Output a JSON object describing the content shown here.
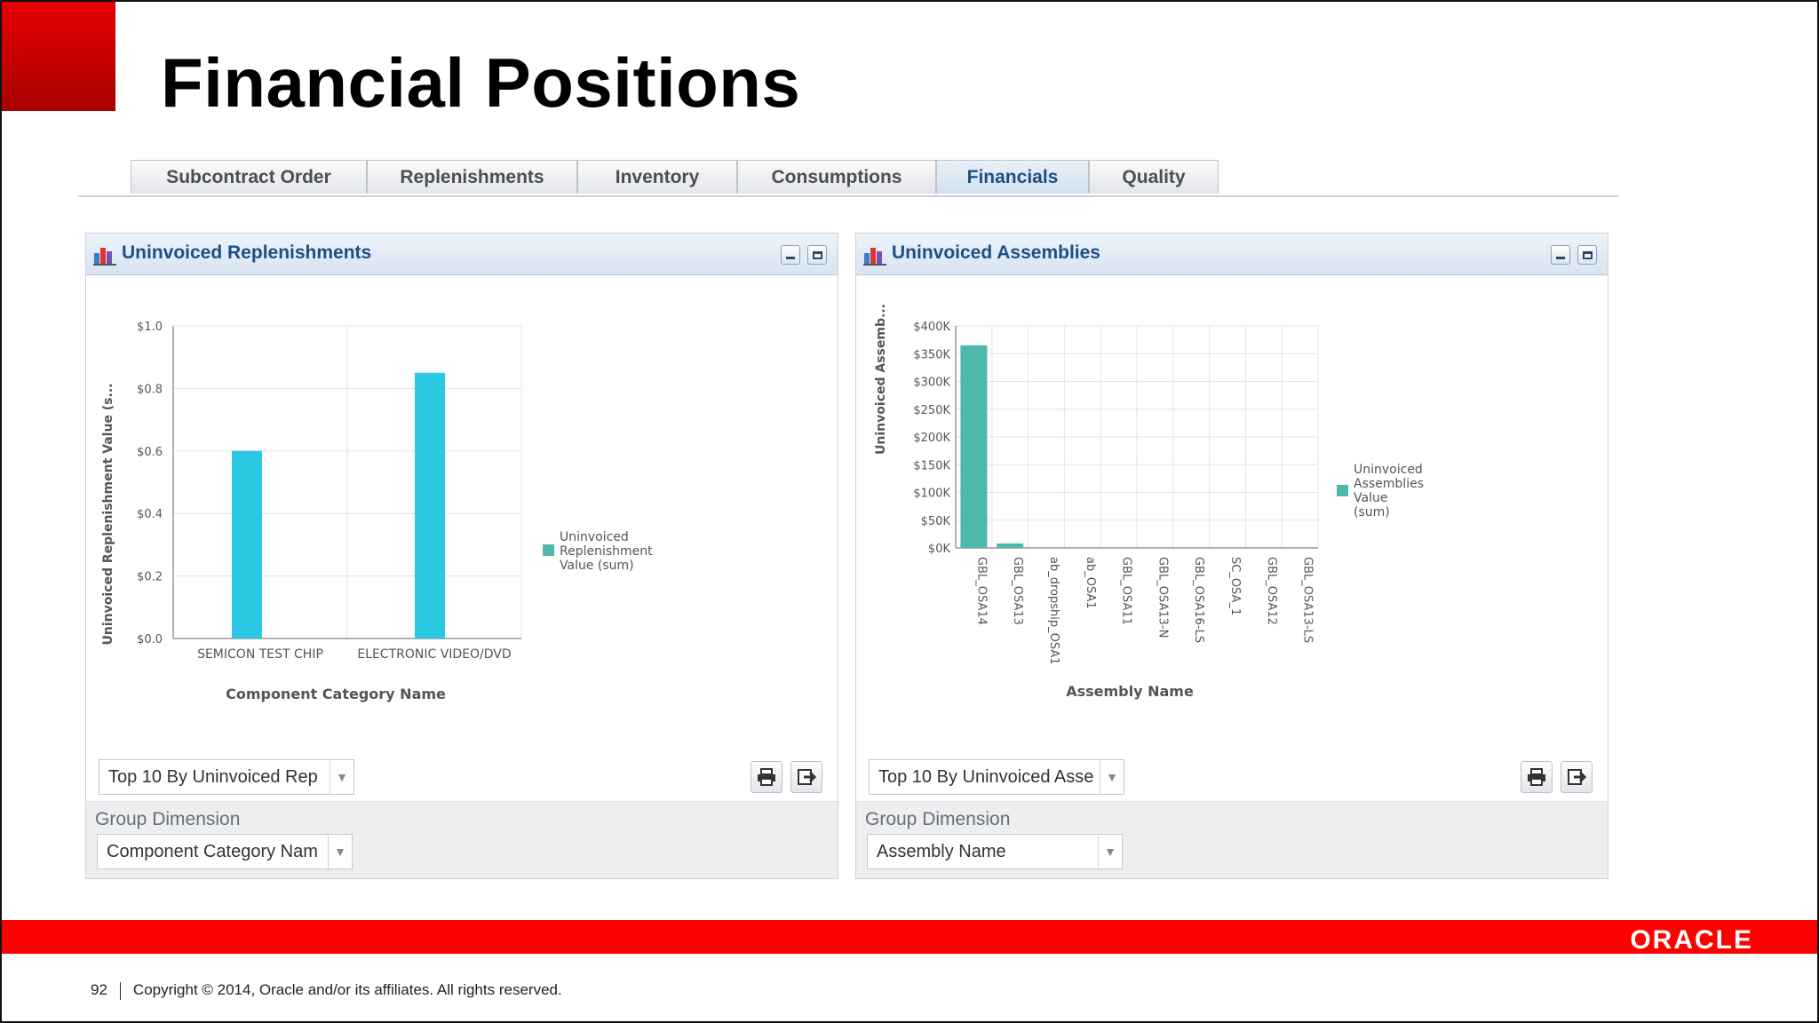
{
  "slide": {
    "title": "Financial Positions",
    "page_number": "92",
    "copyright": "Copyright © 2014, Oracle and/or its affiliates. All rights reserved.",
    "logo_text": "ORACLE"
  },
  "tabs": [
    {
      "label": "Subcontract Order",
      "active": false
    },
    {
      "label": "Replenishments",
      "active": false
    },
    {
      "label": "Inventory",
      "active": false
    },
    {
      "label": "Consumptions",
      "active": false
    },
    {
      "label": "Financials",
      "active": true
    },
    {
      "label": "Quality",
      "active": false
    }
  ],
  "colors": {
    "bar_left": "#2bc8e4",
    "bar_right": "#4fb8ad",
    "legend_swatch": "#4fb8ad",
    "accent_red": "#ff0000",
    "panel_title": "#1d4f86"
  },
  "panels": {
    "left": {
      "title": "Uninvoiced Replenishments",
      "filter_value": "Top 10 By Uninvoiced Rep",
      "group_label": "Group Dimension",
      "group_value": "Component Category Nam"
    },
    "right": {
      "title": "Uninvoiced Assemblies",
      "filter_value": "Top 10 By Uninvoiced Asse",
      "group_label": "Group Dimension",
      "group_value": "Assembly Name"
    }
  },
  "chart_data": [
    {
      "type": "bar",
      "ylabel": "Uninvoiced Replenishment Value (s...",
      "xlabel": "Component Category Name",
      "categories": [
        "SEMICON TEST CHIP",
        "ELECTRONIC VIDEO/DVD"
      ],
      "series": [
        {
          "name": "Uninvoiced Replenishment Value (sum)",
          "values": [
            0.6,
            0.85
          ]
        }
      ],
      "ylim": [
        0,
        1.0
      ],
      "yticks": [
        "$0.0",
        "$0.2",
        "$0.4",
        "$0.6",
        "$0.8",
        "$1.0"
      ],
      "legend": [
        "Uninvoiced",
        "Replenishment",
        "Value (sum)"
      ],
      "grid": true,
      "legend_position": "right"
    },
    {
      "type": "bar",
      "ylabel": "Uninvoiced Assemb...",
      "xlabel": "Assembly Name",
      "categories": [
        "GBL_OSA14",
        "GBL_OSA13",
        "ab_dropship_OSA1",
        "ab_OSA1",
        "GBL_OSA11",
        "GBL_OSA13-N",
        "GBL_OSA16-LS",
        "SC_OSA_1",
        "GBL_OSA12",
        "GBL_OSA13-LS"
      ],
      "series": [
        {
          "name": "Uninvoiced Assemblies Value (sum)",
          "values": [
            365000,
            8000,
            0,
            0,
            0,
            0,
            0,
            0,
            0,
            0
          ]
        }
      ],
      "ylim": [
        0,
        400000
      ],
      "yticks": [
        "$0K",
        "$50K",
        "$100K",
        "$150K",
        "$200K",
        "$250K",
        "$300K",
        "$350K",
        "$400K"
      ],
      "legend": [
        "Uninvoiced",
        "Assemblies",
        "Value",
        "(sum)"
      ],
      "grid": true,
      "legend_position": "right"
    }
  ]
}
